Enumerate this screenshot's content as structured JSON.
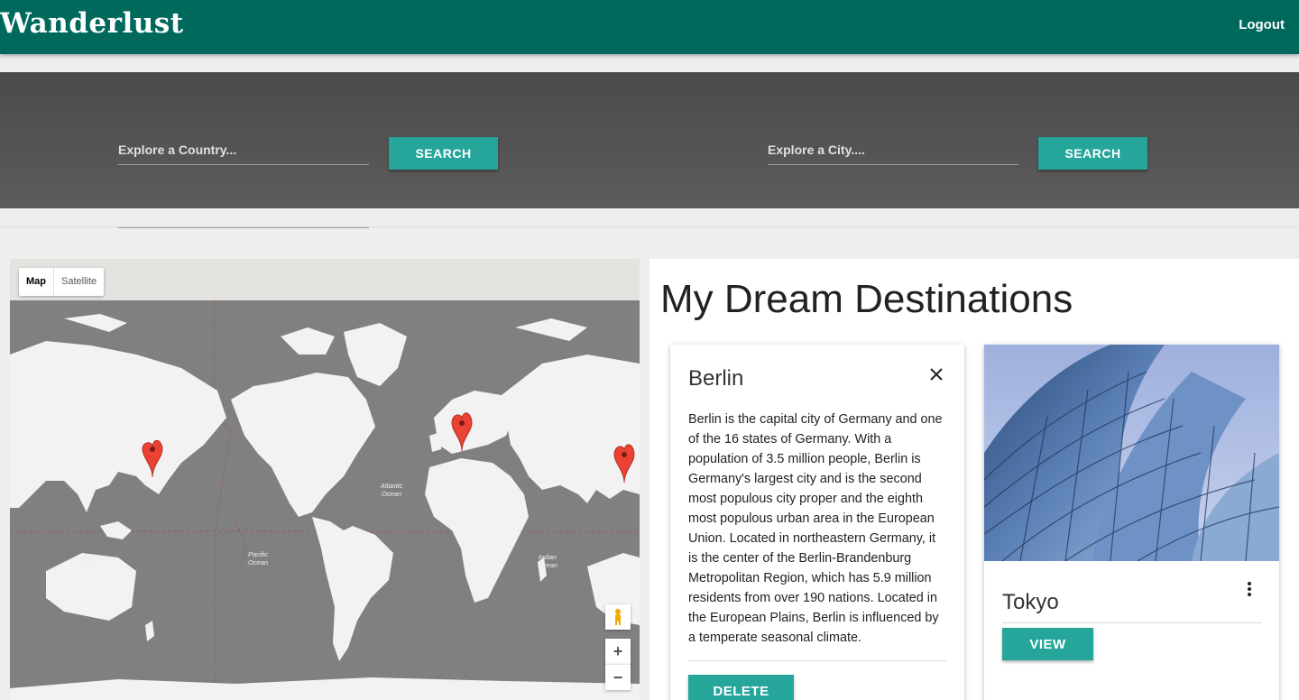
{
  "header": {
    "brand": "Wanderlust",
    "logout_label": "Logout"
  },
  "search": {
    "country_placeholder": "Explore a Country...",
    "country_button": "SEARCH",
    "city_placeholder": "Explore a City....",
    "city_button": "SEARCH"
  },
  "map": {
    "type_map": "Map",
    "type_satellite": "Satellite",
    "zoom_in": "+",
    "zoom_out": "−",
    "ocean_labels": {
      "atlantic": [
        "Atlantic",
        "Ocean"
      ],
      "pacific": [
        "Pacific",
        "Ocean"
      ],
      "indian_left": [
        "Indian",
        "Ocean"
      ],
      "indian_right": [
        "Indian",
        "Ocean"
      ]
    },
    "marker_count": 3,
    "marker_color": "#ea4335"
  },
  "destinations": {
    "title": "My Dream Destinations",
    "cards": [
      {
        "name": "Berlin",
        "description": "Berlin is the capital city of Germany and one of the 16 states of Germany. With a population of 3.5 million people, Berlin is Germany's largest city and is the second most populous city proper and the eighth most populous urban area in the European Union. Located in northeastern Germany, it is the center of the Berlin-Brandenburg Metropolitan Region, which has 5.9 million residents from over 190 nations. Located in the European Plains, Berlin is influenced by a temperate seasonal climate.",
        "action_label": "DELETE",
        "icon": "close-icon"
      },
      {
        "name": "Tokyo",
        "action_label": "VIEW",
        "icon": "more-vertical-icon"
      }
    ]
  },
  "colors": {
    "primary": "#00695c",
    "accent": "#26a69a",
    "search_band": "#555555",
    "map_water": "#808080",
    "map_land": "#f2f2f2"
  }
}
